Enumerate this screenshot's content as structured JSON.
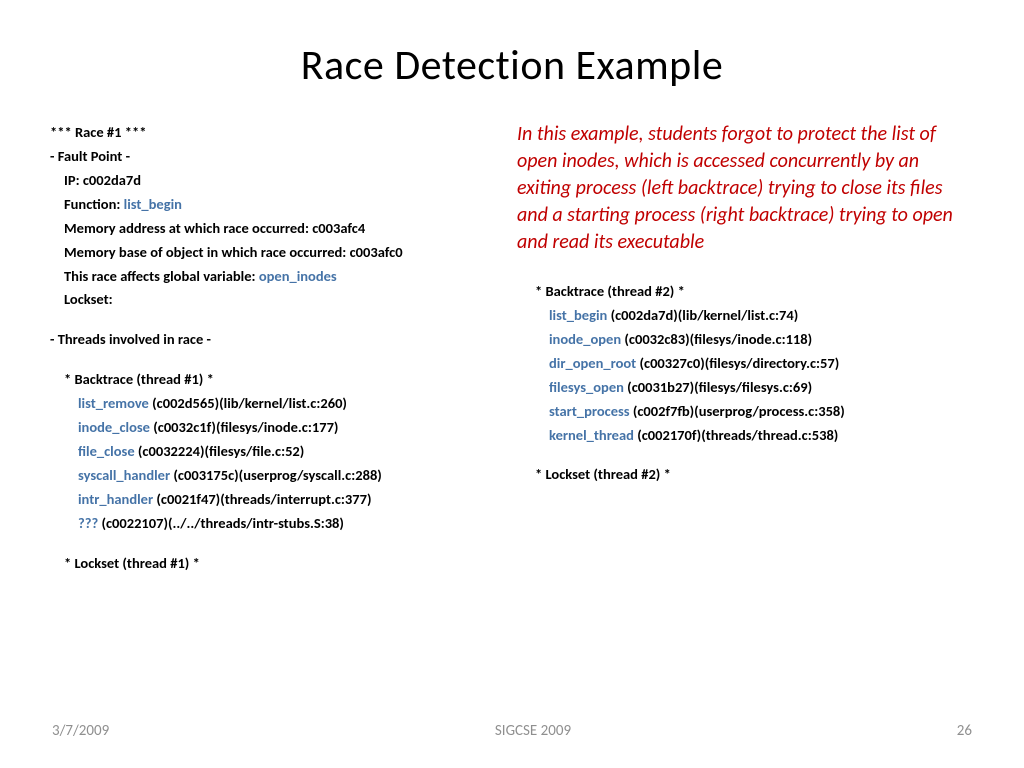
{
  "title": "Race Detection Example",
  "fault": {
    "race_hdr": "*** Race #1 ***",
    "fault_hdr": "- Fault Point -",
    "ip_label": "IP: c002da7d",
    "func_label": "Function: ",
    "func_name": "list_begin",
    "mem_addr": "Memory address at which race occurred: c003afc4",
    "mem_base": "Memory base of object in which race occurred: c003afc0",
    "global_label": "This race affects global variable: ",
    "global_name": "open_inodes",
    "lockset": "Lockset:"
  },
  "threads_hdr": "- Threads involved in race -",
  "bt1": {
    "hdr": "* Backtrace (thread #1) *",
    "lines": [
      {
        "fn": "list_remove",
        "rest": " (c002d565)(lib/kernel/list.c:260)"
      },
      {
        "fn": "inode_close",
        "rest": " (c0032c1f)(filesys/inode.c:177)"
      },
      {
        "fn": "file_close",
        "rest": " (c0032224)(filesys/file.c:52)"
      },
      {
        "fn": "syscall_handler",
        "rest": " (c003175c)(userprog/syscall.c:288)"
      },
      {
        "fn": "intr_handler",
        "rest": " (c0021f47)(threads/interrupt.c:377)"
      },
      {
        "fn": "???",
        "rest": " (c0022107)(../../threads/intr-stubs.S:38)"
      }
    ],
    "lockset": "* Lockset (thread #1) *"
  },
  "explain": "In this example, students forgot to protect the list of open inodes, which is accessed concurrently by an exiting process (left backtrace) trying to close its files and a starting process (right backtrace) trying to open and read its executable",
  "bt2": {
    "hdr": "* Backtrace (thread #2) *",
    "lines": [
      {
        "fn": "list_begin",
        "rest": " (c002da7d)(lib/kernel/list.c:74)"
      },
      {
        "fn": "inode_open",
        "rest": " (c0032c83)(filesys/inode.c:118)"
      },
      {
        "fn": "dir_open_root",
        "rest": " (c00327c0)(filesys/directory.c:57)"
      },
      {
        "fn": "filesys_open",
        "rest": " (c0031b27)(filesys/filesys.c:69)"
      },
      {
        "fn": "start_process",
        "rest": " (c002f7fb)(userprog/process.c:358)"
      },
      {
        "fn": "kernel_thread",
        "rest": " (c002170f)(threads/thread.c:538)"
      }
    ],
    "lockset": "* Lockset (thread #2) *"
  },
  "footer": {
    "date": "3/7/2009",
    "venue": "SIGCSE 2009",
    "page": "26"
  }
}
